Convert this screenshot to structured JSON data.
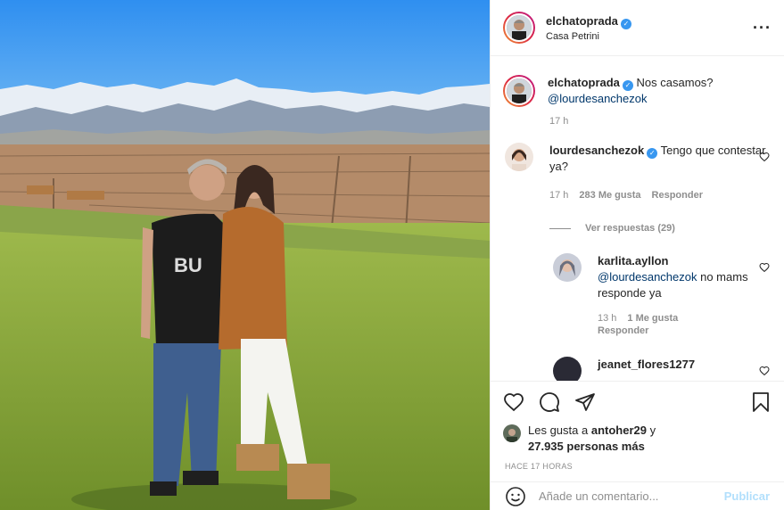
{
  "post": {
    "username": "elchatoprada",
    "location": "Casa Petrini",
    "more_icon": "more-horizontal-icon",
    "verified_icon": "verified-badge-icon"
  },
  "caption": {
    "username": "elchatoprada",
    "text": "Nos casamos?",
    "mention": "@lourdesanchezok",
    "time": "17 h"
  },
  "comments": [
    {
      "username": "lourdesanchezok",
      "text": "Tengo que contestar ya?",
      "time": "17 h",
      "likes": "283 Me gusta",
      "reply_label": "Responder",
      "view_replies": "Ver respuestas (29)"
    }
  ],
  "replies": [
    {
      "username": "karlita.ayllon",
      "mention": "@lourdesanchezok",
      "text": "no mams responde ya",
      "time": "13 h",
      "likes": "1 Me gusta",
      "reply_label": "Responder"
    },
    {
      "username": "jeanet_flores1277"
    }
  ],
  "actions": {
    "like_icon": "heart-icon",
    "comment_icon": "comment-icon",
    "share_icon": "send-icon",
    "save_icon": "bookmark-icon"
  },
  "likes": {
    "prefix": "Les gusta a",
    "user": "antoher29",
    "joiner": "y",
    "count": "27.935 personas más"
  },
  "posted_ago": "HACE 17 HORAS",
  "add_comment": {
    "placeholder": "Añade un comentario...",
    "publish_label": "Publicar",
    "emoji_icon": "emoji-icon"
  },
  "colors": {
    "link": "#00376b",
    "muted": "#8e8e8e",
    "verified": "#3897f0",
    "publish_disabled": "#b2dffc"
  }
}
